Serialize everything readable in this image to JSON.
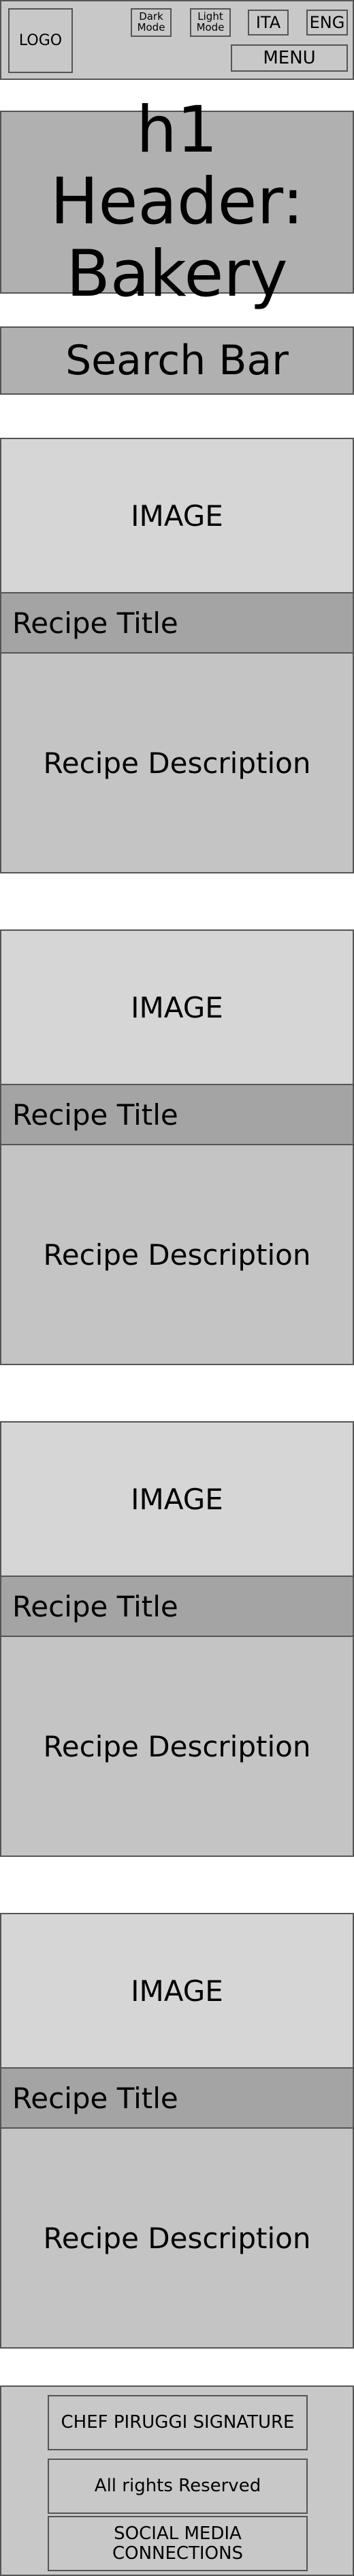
{
  "topbar": {
    "logo": "LOGO",
    "dark_mode": "Dark\nMode",
    "light_mode": "Light\nMode",
    "lang_ita": "ITA",
    "lang_eng": "ENG",
    "menu": "MENU"
  },
  "header": {
    "title": "h1 Header:\nBakery"
  },
  "search": {
    "label": "Search Bar"
  },
  "recipes": [
    {
      "image": "IMAGE",
      "title": "Recipe Title",
      "description": "Recipe Description"
    },
    {
      "image": "IMAGE",
      "title": "Recipe Title",
      "description": "Recipe Description"
    },
    {
      "image": "IMAGE",
      "title": "Recipe Title",
      "description": "Recipe Description"
    },
    {
      "image": "IMAGE",
      "title": "Recipe Title",
      "description": "Recipe Description"
    }
  ],
  "footer": {
    "signature": "CHEF PIRUGGI SIGNATURE",
    "rights": "All rights Reserved",
    "social": "SOCIAL MEDIA\nCONNECTIONS"
  }
}
